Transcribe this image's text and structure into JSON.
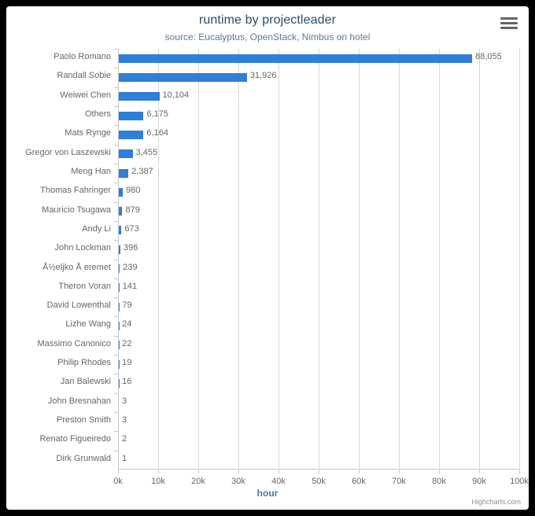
{
  "chart_data": {
    "type": "bar",
    "title": "runtime by projectleader",
    "subtitle": "source: Eucalyptus, OpenStack, Nimbus on hotel",
    "xlabel": "hour",
    "ylabel": "",
    "orientation": "horizontal",
    "xlim": [
      0,
      100000
    ],
    "grid": true,
    "legend": false,
    "xtick_labels": [
      "0k",
      "10k",
      "20k",
      "30k",
      "40k",
      "50k",
      "60k",
      "70k",
      "80k",
      "90k",
      "100k"
    ],
    "xtick_values": [
      0,
      10000,
      20000,
      30000,
      40000,
      50000,
      60000,
      70000,
      80000,
      90000,
      100000
    ],
    "bar_color": "#2f7ed8",
    "categories": [
      "Paolo Romano",
      "Randall Sobie",
      "Weiwei Chen",
      "Others",
      "Mats Rynge",
      "Gregor von Laszewski",
      "Meng Han",
      "Thomas Fahringer",
      "Mauricio Tsugawa",
      "Andy Li",
      "John Lockman",
      "Å½eljko Å eremet",
      "Theron Voran",
      "David Lowenthal",
      "Lizhe Wang",
      "Massimo Canonico",
      "Philip Rhodes",
      "Jan Balewski",
      "John Bresnahan",
      "Preston Smith",
      "Renato Figueiredo",
      "Dirk Grunwald"
    ],
    "values": [
      88055,
      31926,
      10104,
      6175,
      6164,
      3455,
      2387,
      980,
      879,
      673,
      396,
      239,
      141,
      79,
      24,
      22,
      19,
      16,
      3,
      3,
      2,
      1
    ],
    "value_labels": [
      "88,055",
      "31,926",
      "10,104",
      "6,175",
      "6,164",
      "3,455",
      "2,387",
      "980",
      "879",
      "673",
      "396",
      "239",
      "141",
      "79",
      "24",
      "22",
      "19",
      "16",
      "3",
      "3",
      "2",
      "1"
    ]
  },
  "credits": {
    "text": "Highcharts.com"
  },
  "menu": {
    "name": "context-menu"
  }
}
